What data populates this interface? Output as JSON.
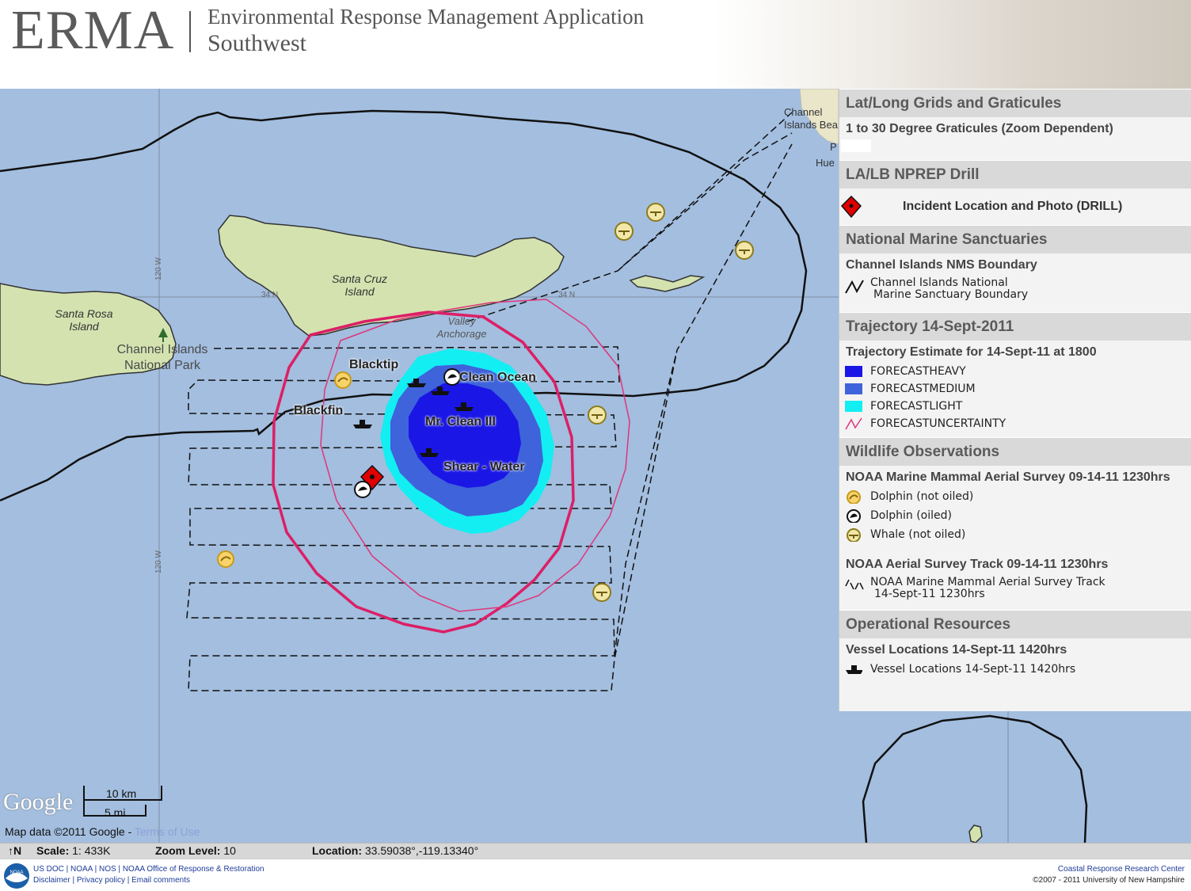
{
  "header": {
    "logo": "ERMA",
    "title_line1": "Environmental Response Management Application",
    "title_line2": "Southwest"
  },
  "map": {
    "place_labels": {
      "santa_cruz": "Santa Cruz\nIsland",
      "santa_rosa": "Santa Rosa\nIsland",
      "valley_anchorage": "Valley\nAnchorage",
      "park": "Channel Islands\nNational Park",
      "coast_town": "Channel\nIslands Bea",
      "coast_p": "P",
      "coast_hue": "Hue"
    },
    "grid_labels": {
      "lat_left": "34 N",
      "lat_right": "34 N",
      "lon_top": "120 W",
      "lon_bottom": "120 W"
    },
    "vessel_names": {
      "blacktip": "Blacktip",
      "blackfin": "Blackfin",
      "clean_ocean": "Clean Ocean",
      "mr_clean": "Mr. Clean III",
      "shear_water": "Shear - Water"
    },
    "attribution": {
      "google": "Google",
      "scale_km": "10 km",
      "scale_mi": "5 mi",
      "map_data": "Map data ©2011 Google -",
      "terms": "Terms of Use"
    },
    "colors": {
      "water": "#a3bedf",
      "land": "#d4e2b0",
      "forecast_heavy": "#1a16e6",
      "forecast_medium": "#3f63da",
      "forecast_light": "#13eef2",
      "forecast_uncertainty": "#e0357a"
    }
  },
  "legend": {
    "sections": [
      {
        "title": "Lat/Long Grids and Graticules",
        "sub": "1 to 30 Degree Graticules (Zoom Dependent)"
      },
      {
        "title": "LA/LB NPREP Drill",
        "item": "Incident Location and Photo (DRILL)"
      },
      {
        "title": "National Marine Sanctuaries",
        "sub": "Channel Islands NMS Boundary",
        "item_line1": "Channel Islands National",
        "item_line2": "Marine Sanctuary Boundary"
      },
      {
        "title": "Trajectory 14-Sept-2011",
        "sub": "Trajectory Estimate for 14-Sept-11 at 1800",
        "items": [
          "FORECASTHEAVY",
          "FORECASTMEDIUM",
          "FORECASTLIGHT",
          "FORECASTUNCERTAINTY"
        ]
      },
      {
        "title": "Wildlife Observations",
        "sub": "NOAA Marine Mammal Aerial Survey 09-14-11 1230hrs",
        "items": [
          "Dolphin (not oiled)",
          "Dolphin (oiled)",
          "Whale (not oiled)"
        ],
        "sub2": "NOAA Aerial Survey Track 09-14-11 1230hrs",
        "track_line1": "NOAA Marine Mammal Aerial Survey Track",
        "track_line2": "14-Sept-11 1230hrs"
      },
      {
        "title": "Operational Resources",
        "sub": "Vessel Locations 14-Sept-11 1420hrs",
        "item": "Vessel Locations 14-Sept-11 1420hrs"
      }
    ]
  },
  "status": {
    "north": "N",
    "scale_label": "Scale:",
    "scale_value": "1: 433K",
    "zoom_label": "Zoom Level:",
    "zoom_value": "10",
    "location_label": "Location:",
    "location_value": "33.59038°,-119.13340°"
  },
  "footer": {
    "links_line1": "US DOC | NOAA | NOS | NOAA Office of Response & Restoration",
    "links_line2": "Disclaimer | Privacy policy | Email comments",
    "noaa_logo": "NOAA",
    "right_line1": "Coastal Response Research Center",
    "right_line2": "©2007 - 2011 University of New Hampshire"
  }
}
